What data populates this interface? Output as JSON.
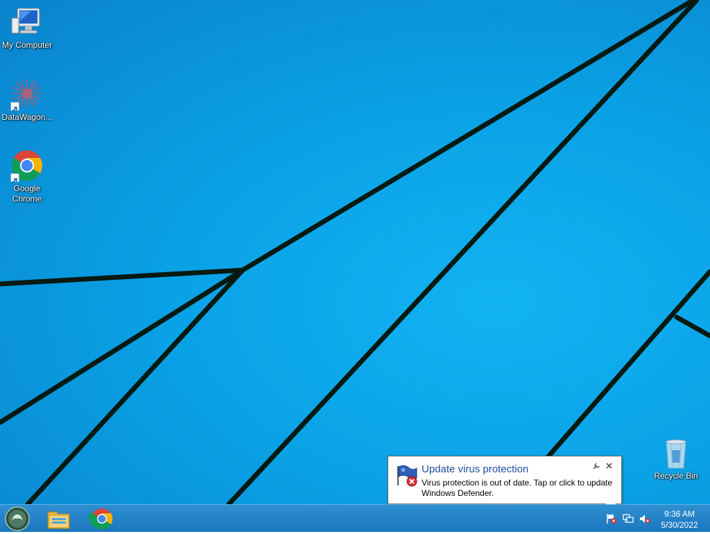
{
  "desktop": {
    "icons": [
      {
        "label": "My Computer",
        "icon": "computer-icon"
      },
      {
        "label": "DataWagon...",
        "icon": "datawagon-icon"
      },
      {
        "label": "Google Chrome",
        "icon": "chrome-icon"
      },
      {
        "label": "Recycle Bin",
        "icon": "recycle-bin-icon"
      }
    ]
  },
  "notification": {
    "title": "Update virus protection",
    "body": "Virus protection is out of date. Tap or click to update Windows Defender.",
    "icon": "defender-flag-error-icon",
    "options_icon": "wrench-icon",
    "close_icon": "close-icon",
    "title_color": "#1f4fa0"
  },
  "taskbar": {
    "start_icon": "start-orb-icon",
    "pinned": [
      {
        "icon": "file-explorer-icon"
      },
      {
        "icon": "chrome-icon"
      }
    ],
    "tray": [
      {
        "icon": "action-center-flag-error-icon"
      },
      {
        "icon": "network-icon"
      },
      {
        "icon": "volume-muted-icon"
      }
    ],
    "time": "9:36 AM",
    "date": "5/30/2022"
  },
  "colors": {
    "wallpaper": "#0aa2e6",
    "taskbar": "#1f7ec4",
    "wallpaper_lines": "#061a14"
  }
}
